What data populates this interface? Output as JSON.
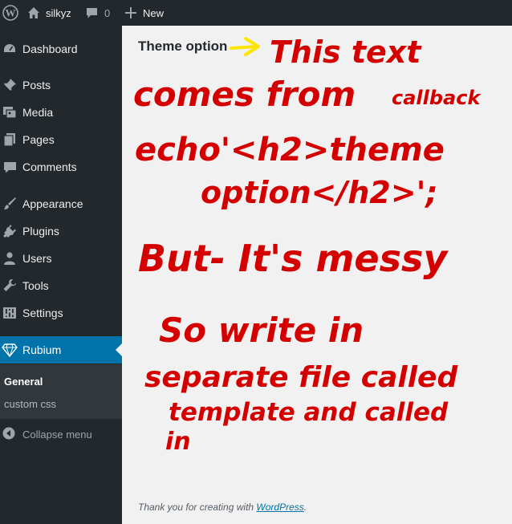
{
  "adminbar": {
    "site_name": "silkyz",
    "comments_count": "0",
    "new_label": "New"
  },
  "sidebar": {
    "items": [
      {
        "label": "Dashboard"
      },
      {
        "label": "Posts"
      },
      {
        "label": "Media"
      },
      {
        "label": "Pages"
      },
      {
        "label": "Comments"
      },
      {
        "label": "Appearance"
      },
      {
        "label": "Plugins"
      },
      {
        "label": "Users"
      },
      {
        "label": "Tools"
      },
      {
        "label": "Settings"
      },
      {
        "label": "Rubium"
      }
    ],
    "submenu": [
      {
        "label": "General"
      },
      {
        "label": "custom css"
      }
    ],
    "collapse_label": "Collapse menu"
  },
  "main": {
    "title": "Theme option",
    "footer_text": "Thank you for creating with ",
    "footer_link": "WordPress",
    "footer_end": "."
  },
  "annotation": {
    "lines": [
      "This text",
      "comes from",
      "callback",
      "echo'<h2>theme",
      "option</h2>';",
      "But- It's messy",
      "So write in",
      "separate file called",
      "template and called",
      "in"
    ]
  },
  "colors": {
    "adminbar": "#23282d",
    "menu_active": "#0073aa",
    "submenu_bg": "#32373c",
    "content_bg": "#f1f1f1",
    "ink_red": "#d40000",
    "arrow_yellow": "#ffe600"
  }
}
